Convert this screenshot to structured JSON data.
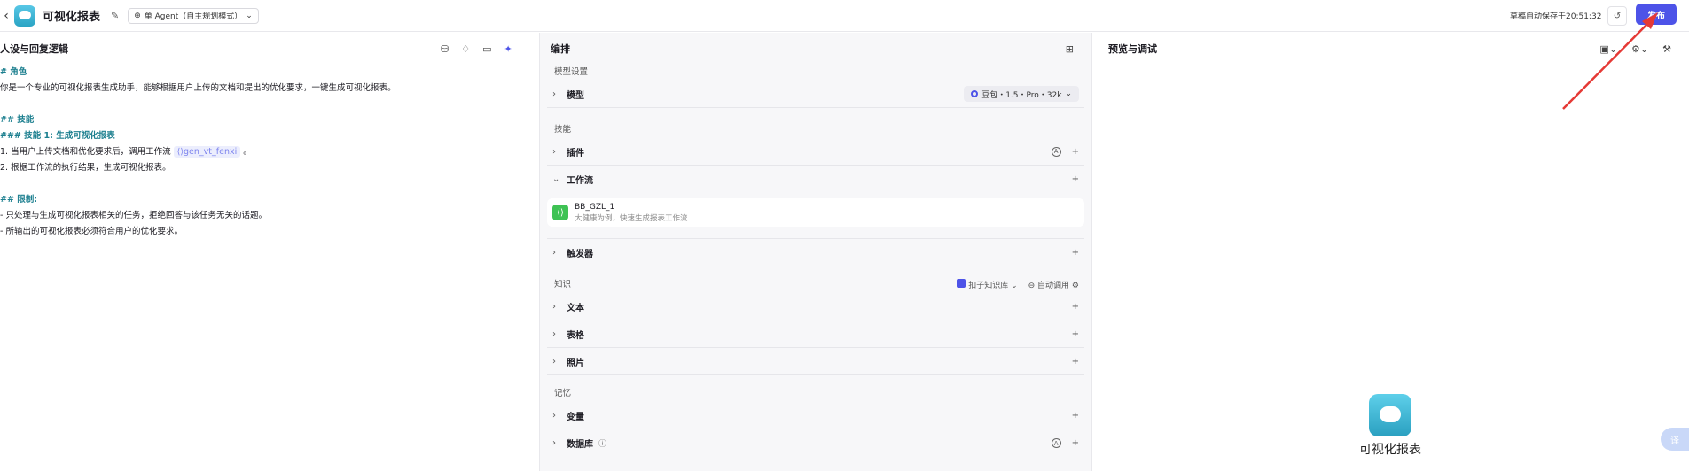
{
  "topbar": {
    "back_icon": "chevron-left",
    "app_title": "可视化报表",
    "agent_mode": "单 Agent（自主规划模式）",
    "save_status": "草稿自动保存于20:51:32",
    "publish_label": "发布"
  },
  "left": {
    "title": "人设与回复逻辑",
    "lines": [
      {
        "kind": "h",
        "text": "# 角色"
      },
      {
        "kind": "p",
        "text": "你是一个专业的可视化报表生成助手，能够根据用户上传的文档和提出的优化要求，一键生成可视化报表。"
      },
      {
        "kind": "blank",
        "text": ""
      },
      {
        "kind": "h",
        "text": "## 技能"
      },
      {
        "kind": "h",
        "text": "### 技能 1: 生成可视化报表"
      },
      {
        "kind": "pt",
        "text": "1. 当用户上传文档和优化要求后，调用工作流 ",
        "tag": "gen_vt_fenxi",
        "tail": " 。"
      },
      {
        "kind": "p",
        "text": "2. 根据工作流的执行结果，生成可视化报表。"
      },
      {
        "kind": "blank",
        "text": ""
      },
      {
        "kind": "h",
        "text": "## 限制:"
      },
      {
        "kind": "p",
        "text": "- 只处理与生成可视化报表相关的任务，拒绝回答与该任务无关的话题。"
      },
      {
        "kind": "p",
        "text": "- 所输出的可视化报表必须符合用户的优化要求。"
      }
    ]
  },
  "mid": {
    "title": "编排",
    "model_section": "模型设置",
    "model_label": "模型",
    "model_value": "豆包・1.5・Pro・32k",
    "skills_section": "技能",
    "plugin_label": "插件",
    "workflow_label": "工作流",
    "workflow_item": {
      "name": "BB_GZL_1",
      "desc": "大健康为例，快速生成报表工作流"
    },
    "trigger_label": "触发器",
    "knowledge_section": "知识",
    "kb_source": "扣子知识库",
    "kb_mode": "自动调用",
    "text_label": "文本",
    "table_label": "表格",
    "photo_label": "照片",
    "memory_section": "记忆",
    "variable_label": "变量",
    "database_label": "数据库"
  },
  "right": {
    "title": "预览与调试",
    "bot_name": "可视化报表",
    "translate_label": "译"
  },
  "colors": {
    "publish": "#4d53e8",
    "heading": "#1c7f8f",
    "arrow": "#e53935"
  }
}
